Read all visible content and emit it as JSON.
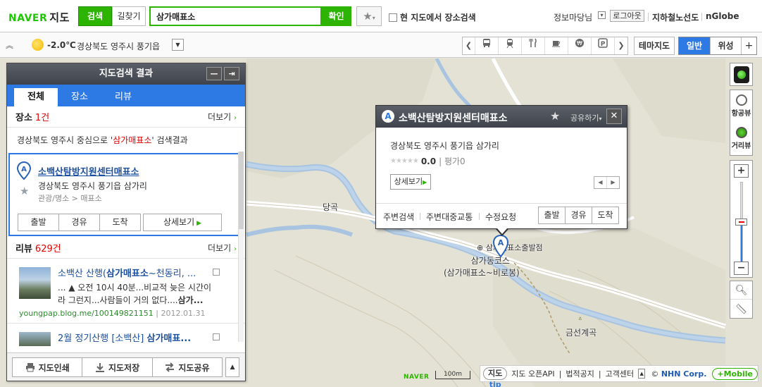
{
  "header": {
    "logo_brand": "NAVER",
    "logo_service": "지도",
    "tab_search": "검색",
    "tab_route": "길찾기",
    "search_value": "삼가매표소",
    "confirm": "확인",
    "fav_icon": "star-icon",
    "local_search_label": "현 지도에서 장소검색",
    "user_name": "정보마당님",
    "logout": "로그아웃",
    "subway_map": "지하철노선도",
    "nglobe": "nGlobe"
  },
  "subbar": {
    "temperature": "-2.0℃",
    "location": "경상북도 영주시 풍기읍",
    "poi_icons": [
      "bus-icon",
      "train-icon",
      "restaurant-icon",
      "cafe-icon",
      "bank-icon",
      "parking-icon"
    ],
    "theme_map": "테마지도",
    "map_normal": "일반",
    "map_satellite": "위성",
    "map_more": "+"
  },
  "panel": {
    "title": "지도검색 결과",
    "tabs": [
      "전체",
      "장소",
      "리뷰"
    ],
    "place_section": {
      "title": "장소",
      "count": "1건",
      "more": "더보기"
    },
    "info": {
      "prefix": "경상북도 영주시 중심으로 '",
      "query": "삼가매표소",
      "suffix": "' 검색결과"
    },
    "result": {
      "name": "소백산탐방지원센터매표소",
      "address": "경상북도 영주시 풍기읍 삼가리",
      "category": "관광/명소 > 매표소",
      "buttons": [
        "출발",
        "경유",
        "도착"
      ],
      "detail": "상세보기"
    },
    "review_section": {
      "title": "리뷰",
      "count": "629건",
      "more": "더보기"
    },
    "reviews": [
      {
        "title_pre": "소백산 산행(",
        "title_bold": "삼가매표소",
        "title_post": "~천동리, ...",
        "body_line1": "... ▲ 오전 10시 40분...비교적 늦은 시간이",
        "body_line2_pre": "라 그런지...사람들이 거의 없다....",
        "body_line2_bold": "삼가...",
        "source": "youngpap.blog.me/100149821151",
        "date": "2012.01.31"
      },
      {
        "title_pre": "2월 정기산행 [소백산] ",
        "title_bold": "삼가매표...",
        "title_post": ""
      }
    ],
    "footer": {
      "print": "지도인쇄",
      "save": "지도저장",
      "share": "지도공유"
    }
  },
  "popup": {
    "marker_letter": "A",
    "title": "소백산탐방지원센터매표소",
    "share": "공유하기",
    "address": "경상북도 영주시 풍기읍 삼가리",
    "score": "0.0",
    "rating_label_pre": "평가",
    "rating_count": "0",
    "detail": "상세보기",
    "links": [
      "주변검색",
      "주변대중교통",
      "수정요청"
    ],
    "buttons": [
      "출발",
      "경유",
      "도착"
    ]
  },
  "map": {
    "labels": {
      "dangok": "당곡",
      "stop": "삼가매표소출발점",
      "course_line1": "삼가동코스",
      "course_line2": "(삼가매표소~비로봉)",
      "geumseon": "금선계곡",
      "marker_letter": "A"
    },
    "scale": "100m",
    "naver_mark": "NAVER"
  },
  "controls": {
    "aerial_view": "항공뷰",
    "street_view": "거리뷰",
    "zoom_level_fraction": 0.5
  },
  "footer": {
    "tip_pre": "지도",
    "tip_post": "tip",
    "links": [
      "지도 오픈API",
      "법적공지",
      "고객센터"
    ],
    "copyright_pre": "© ",
    "copyright_brand": "NHN Corp.",
    "mobile": "+Mobile"
  }
}
